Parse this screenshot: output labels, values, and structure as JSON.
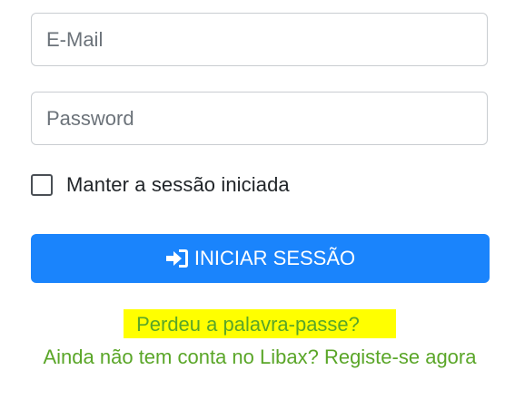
{
  "login": {
    "email_placeholder": "E-Mail",
    "password_placeholder": "Password",
    "remember_label": "Manter a sessão iniciada",
    "submit_label": "INICIAR SESSÃO",
    "forgot_label": "Perdeu a palavra-passe?",
    "register_label": "Ainda não tem conta no Libax? Registe-se agora"
  },
  "icons": {
    "submit": "sign-in-icon"
  },
  "colors": {
    "primary": "#1a84fc",
    "link": "#5aa628",
    "highlight": "#ffff00"
  }
}
